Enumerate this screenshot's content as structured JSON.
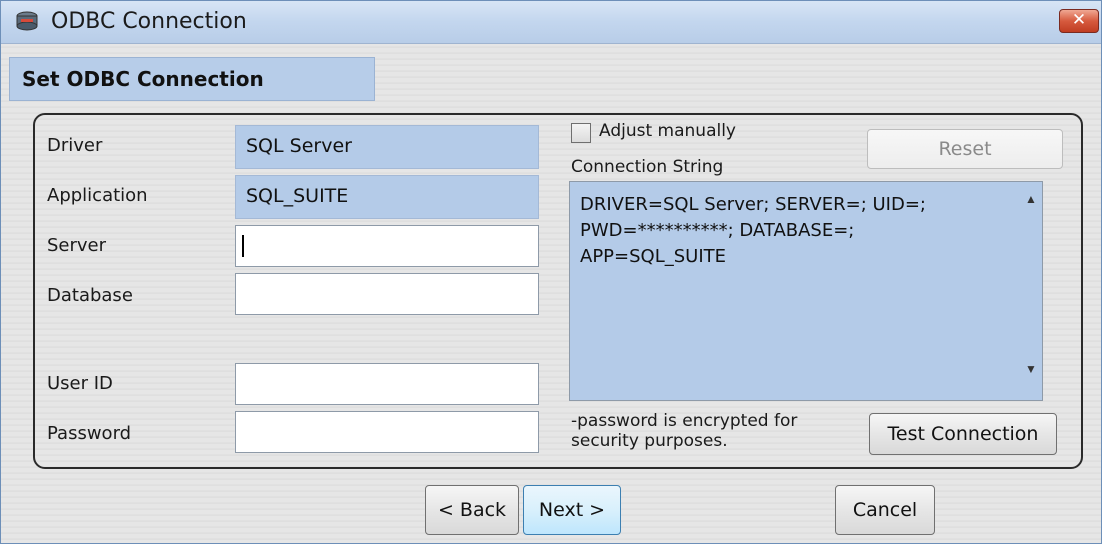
{
  "window": {
    "title": "ODBC Connection",
    "close_glyph": "✕"
  },
  "header": {
    "title": "Set ODBC Connection"
  },
  "form": {
    "fields": [
      {
        "label": "Driver",
        "value": "SQL Server"
      },
      {
        "label": "Application",
        "value": "SQL_SUITE"
      },
      {
        "label": "Server",
        "value": ""
      },
      {
        "label": "Database",
        "value": ""
      },
      {
        "label": "User ID",
        "value": ""
      },
      {
        "label": "Password",
        "value": ""
      }
    ]
  },
  "connection": {
    "adjust_manually_label": "Adjust manually",
    "adjust_manually_checked": false,
    "reset_label": "Reset",
    "connection_string_label": "Connection String",
    "connection_string": "DRIVER=SQL Server; SERVER=; UID=;\nPWD=**********; DATABASE=;\nAPP=SQL_SUITE",
    "note": "-password is encrypted for\nsecurity purposes.",
    "test_label": "Test Connection"
  },
  "footer": {
    "back_label": "< Back",
    "next_label": "Next >",
    "cancel_label": "Cancel"
  },
  "icons": {
    "app": "database-connection-icon",
    "close": "close-icon",
    "scroll_up": "scroll-up-icon",
    "scroll_down": "scroll-down-icon"
  },
  "colors": {
    "readonly_fill": "#b4cbe8",
    "titlebar": "#c3d6ee",
    "close_button": "#d65a3e"
  }
}
